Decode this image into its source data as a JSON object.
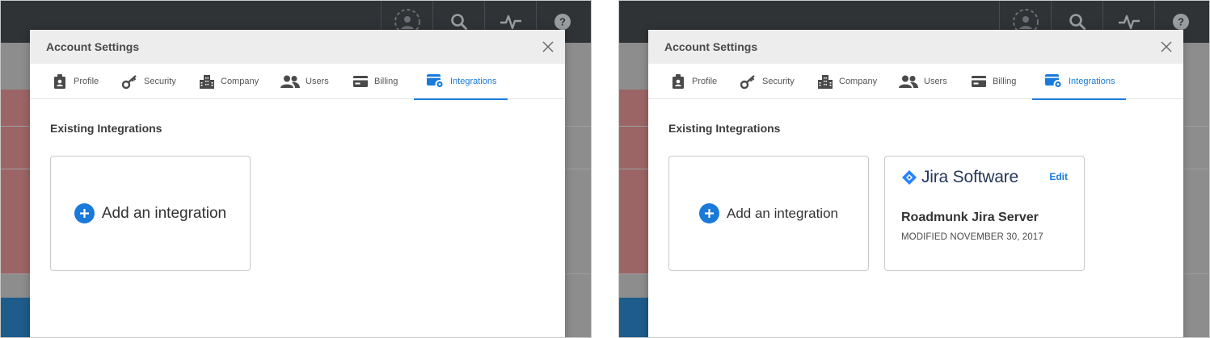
{
  "colors": {
    "accent": "#1a7ad9",
    "topbar": "#2f3336",
    "overlay_red": "#9c6565",
    "overlay_blue": "#1e5c8c"
  },
  "topbar_icons": [
    "collab-icon",
    "search-icon",
    "activity-icon",
    "help-icon"
  ],
  "modal": {
    "title": "Account Settings",
    "tabs": [
      {
        "label": "Profile",
        "icon": "profile-icon"
      },
      {
        "label": "Security",
        "icon": "key-icon"
      },
      {
        "label": "Company",
        "icon": "building-icon"
      },
      {
        "label": "Users",
        "icon": "users-icon"
      },
      {
        "label": "Billing",
        "icon": "billing-icon"
      },
      {
        "label": "Integrations",
        "icon": "integrations-icon",
        "active": true
      }
    ],
    "section_title": "Existing Integrations",
    "add_label": "Add an integration"
  },
  "integration": {
    "brand": "Jira Software",
    "edit_label": "Edit",
    "name": "Roadmunk Jira Server",
    "modified": "MODIFIED NOVEMBER 30, 2017"
  }
}
